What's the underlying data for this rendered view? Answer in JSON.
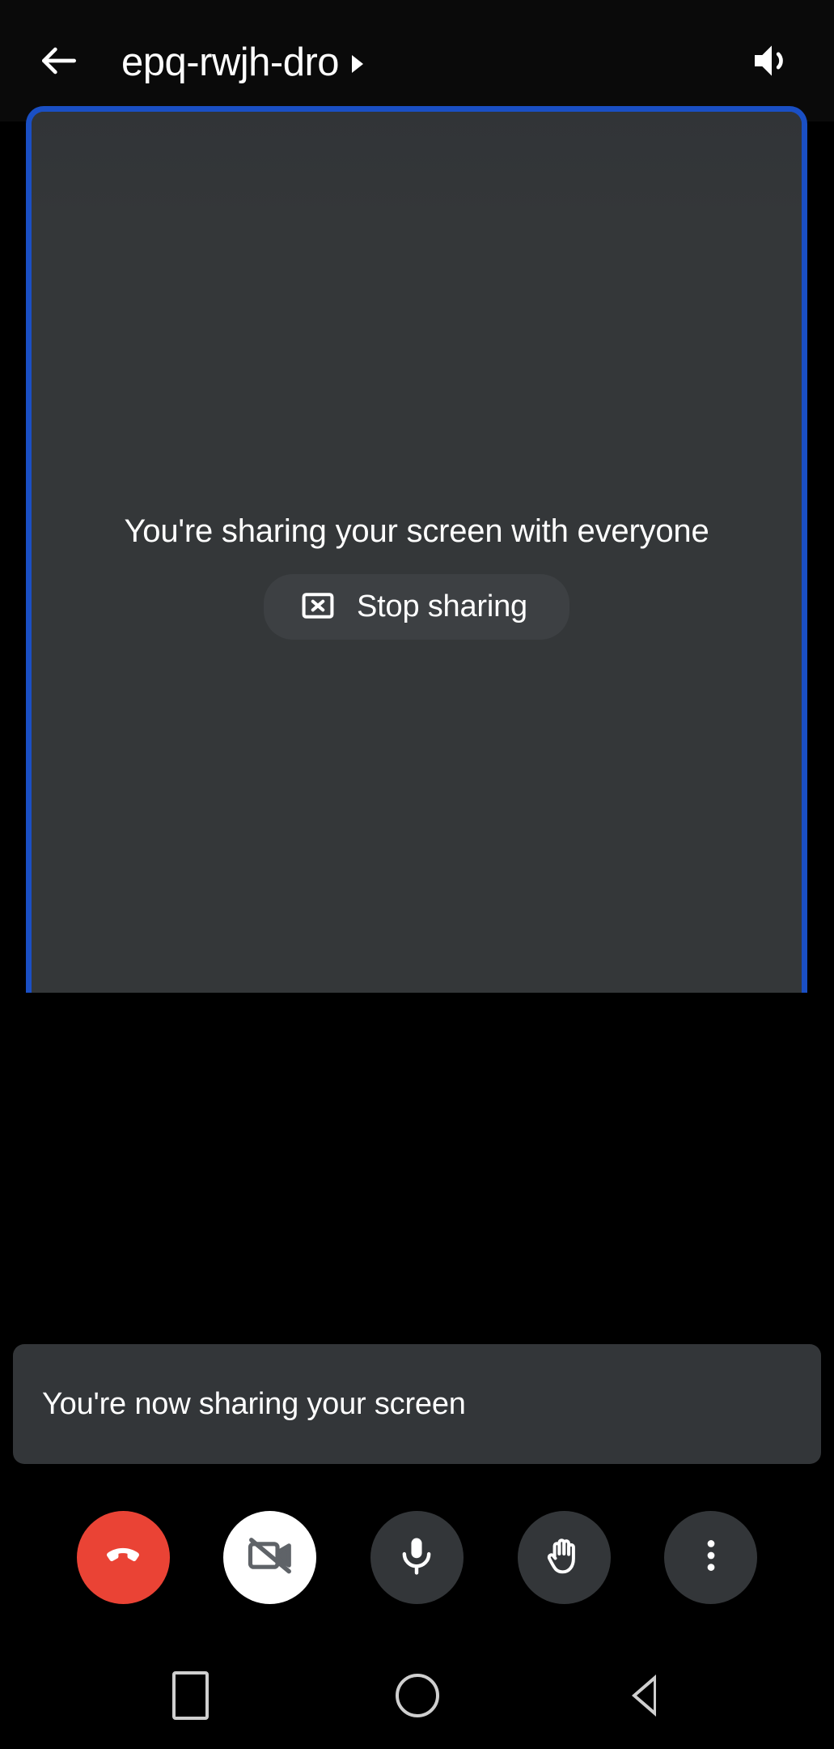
{
  "header": {
    "back_icon": "arrow-left-icon",
    "meeting_code": "epq-rwjh-dro",
    "caret_icon": "caret-right-icon",
    "speaker_icon": "speaker-volume-icon"
  },
  "stage": {
    "border_color": "#1a4fc4",
    "background_color": "#333639",
    "share_message": "You're sharing your screen with everyone",
    "stop_sharing": {
      "label": "Stop sharing",
      "icon": "stop-screen-share-icon"
    }
  },
  "toast": {
    "message": "You're now sharing your screen",
    "background_color": "#333639"
  },
  "controls": [
    {
      "name": "end-call",
      "icon": "phone-hangup-icon",
      "color": "#ea4335",
      "label": "End call"
    },
    {
      "name": "camera",
      "icon": "video-camera-off-icon",
      "color": "#ffffff",
      "label": "Turn on camera"
    },
    {
      "name": "microphone",
      "icon": "microphone-icon",
      "color": "#333639",
      "label": "Mute microphone"
    },
    {
      "name": "raise-hand",
      "icon": "raised-hand-icon",
      "color": "#333639",
      "label": "Raise hand"
    },
    {
      "name": "more-options",
      "icon": "more-vertical-icon",
      "color": "#333639",
      "label": "More options"
    }
  ],
  "navbar": [
    {
      "name": "recents",
      "icon": "square-icon"
    },
    {
      "name": "home",
      "icon": "circle-icon"
    },
    {
      "name": "back",
      "icon": "triangle-left-icon"
    }
  ]
}
